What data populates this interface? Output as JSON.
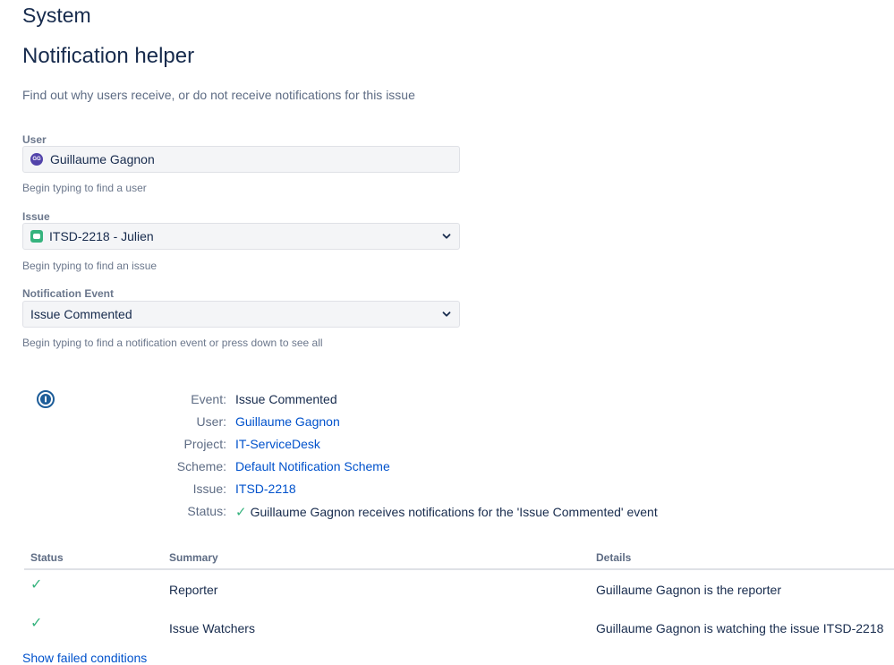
{
  "page": {
    "system_heading": "System",
    "title": "Notification helper",
    "description": "Find out why users receive, or do not receive notifications for this issue"
  },
  "form": {
    "user": {
      "label": "User",
      "avatar_initials": "GG",
      "value": "Guillaume Gagnon",
      "help": "Begin typing to find a user"
    },
    "issue": {
      "label": "Issue",
      "value": "ITSD-2218 - Julien",
      "help": "Begin typing to find an issue"
    },
    "event": {
      "label": "Notification Event",
      "value": "Issue Commented",
      "help": "Begin typing to find a notification event or press down to see all"
    }
  },
  "summary": {
    "event_label": "Event:",
    "event_value": "Issue Commented",
    "user_label": "User:",
    "user_value": "Guillaume Gagnon",
    "project_label": "Project:",
    "project_value": "IT-ServiceDesk",
    "scheme_label": "Scheme:",
    "scheme_value": "Default Notification Scheme",
    "issue_label": "Issue:",
    "issue_value": "ITSD-2218",
    "status_label": "Status:",
    "status_value": "Guillaume Gagnon receives notifications for the 'Issue Commented' event"
  },
  "results": {
    "headers": [
      "Status",
      "Summary",
      "Details"
    ],
    "rows": [
      {
        "summary": "Reporter",
        "details": "Guillaume Gagnon is the reporter"
      },
      {
        "summary": "Issue Watchers",
        "details": "Guillaume Gagnon is watching the issue ITSD-2218"
      }
    ]
  },
  "show_failed": "Show failed conditions",
  "colors": {
    "link": "#0052cc",
    "success": "#36b37e",
    "avatar": "#5243aa"
  }
}
